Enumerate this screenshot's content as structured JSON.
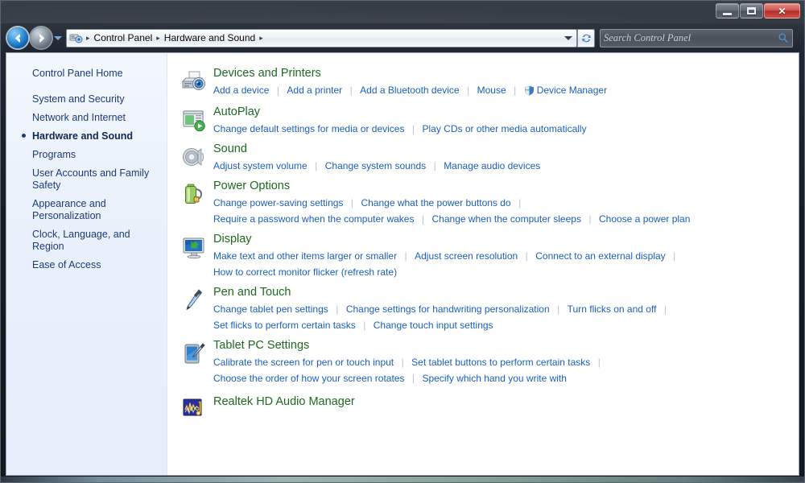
{
  "window": {
    "controls": {
      "minimize_label": "Minimize",
      "maximize_label": "Maximize",
      "close_label": "Close"
    }
  },
  "nav": {
    "back_label": "Back",
    "forward_label": "Forward",
    "history_label": "Recent pages",
    "refresh_label": "Refresh",
    "breadcrumb": [
      "Control Panel",
      "Hardware and Sound"
    ],
    "breadcrumb_separator": "▸"
  },
  "search": {
    "placeholder": "Search Control Panel",
    "value": "",
    "icon": "search-icon"
  },
  "sidebar": {
    "home": "Control Panel Home",
    "items": [
      {
        "label": "System and Security",
        "current": false
      },
      {
        "label": "Network and Internet",
        "current": false
      },
      {
        "label": "Hardware and Sound",
        "current": true
      },
      {
        "label": "Programs",
        "current": false
      },
      {
        "label": "User Accounts and Family Safety",
        "current": false
      },
      {
        "label": "Appearance and Personalization",
        "current": false
      },
      {
        "label": "Clock, Language, and Region",
        "current": false
      },
      {
        "label": "Ease of Access",
        "current": false
      }
    ]
  },
  "categories": [
    {
      "title": "Devices and Printers",
      "icon": "devices-and-printers-icon",
      "rows": [
        [
          {
            "label": "Add a device"
          },
          {
            "label": "Add a printer"
          },
          {
            "label": "Add a Bluetooth device"
          },
          {
            "label": "Mouse"
          },
          {
            "label": "Device Manager",
            "shield": true
          }
        ]
      ]
    },
    {
      "title": "AutoPlay",
      "icon": "autoplay-icon",
      "rows": [
        [
          {
            "label": "Change default settings for media or devices"
          },
          {
            "label": "Play CDs or other media automatically"
          }
        ]
      ]
    },
    {
      "title": "Sound",
      "icon": "sound-icon",
      "rows": [
        [
          {
            "label": "Adjust system volume"
          },
          {
            "label": "Change system sounds"
          },
          {
            "label": "Manage audio devices"
          }
        ]
      ]
    },
    {
      "title": "Power Options",
      "icon": "power-options-icon",
      "rows": [
        [
          {
            "label": "Change power-saving settings"
          },
          {
            "label": "Change what the power buttons do"
          },
          {
            "label": "",
            "trailing_separator": true
          }
        ],
        [
          {
            "label": "Require a password when the computer wakes"
          },
          {
            "label": "Change when the computer sleeps"
          },
          {
            "label": "Choose a power plan"
          }
        ]
      ]
    },
    {
      "title": "Display",
      "icon": "display-icon",
      "rows": [
        [
          {
            "label": "Make text and other items larger or smaller"
          },
          {
            "label": "Adjust screen resolution"
          },
          {
            "label": "Connect to an external display"
          },
          {
            "label": "",
            "trailing_separator": true
          }
        ],
        [
          {
            "label": "How to correct monitor flicker (refresh rate)"
          }
        ]
      ]
    },
    {
      "title": "Pen and Touch",
      "icon": "pen-and-touch-icon",
      "rows": [
        [
          {
            "label": "Change tablet pen settings"
          },
          {
            "label": "Change settings for handwriting personalization"
          },
          {
            "label": "Turn flicks on and off"
          },
          {
            "label": "",
            "trailing_separator": true
          }
        ],
        [
          {
            "label": "Set flicks to perform certain tasks"
          },
          {
            "label": "Change touch input settings"
          }
        ]
      ]
    },
    {
      "title": "Tablet PC Settings",
      "icon": "tablet-pc-settings-icon",
      "rows": [
        [
          {
            "label": "Calibrate the screen for pen or touch input"
          },
          {
            "label": "Set tablet buttons to perform certain tasks"
          },
          {
            "label": "",
            "trailing_separator": true
          }
        ],
        [
          {
            "label": "Choose the order of how your screen rotates"
          },
          {
            "label": "Specify which hand you write with"
          }
        ]
      ]
    },
    {
      "title": "Realtek HD Audio Manager",
      "icon": "realtek-hd-audio-manager-icon",
      "rows": []
    }
  ],
  "colors": {
    "category_title": "#1d6a1f",
    "link": "#1c5fbd",
    "sidebar_text": "#1d3b77",
    "sidebar_bg": "#e8f0fb",
    "titlebar": "#161b24",
    "close_button": "#b5302a"
  }
}
